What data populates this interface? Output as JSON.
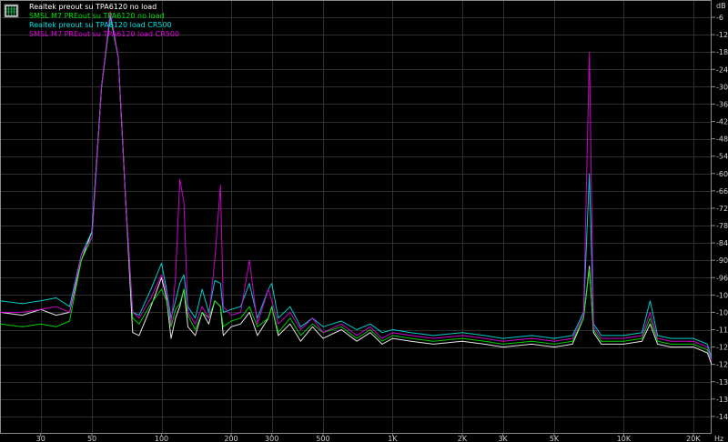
{
  "chart_data": {
    "type": "line",
    "title": "",
    "x_unit": "Hz",
    "y_unit": "dB",
    "x_scale": "log",
    "xlim": [
      20,
      24000
    ],
    "ylim": [
      -150,
      0
    ],
    "grid": true,
    "legend_placement": "top-left",
    "x_ticks": [
      {
        "value": 30,
        "label": "30"
      },
      {
        "value": 50,
        "label": "50"
      },
      {
        "value": 100,
        "label": "100"
      },
      {
        "value": 200,
        "label": "200"
      },
      {
        "value": 300,
        "label": "300"
      },
      {
        "value": 500,
        "label": "500"
      },
      {
        "value": 1000,
        "label": "1K"
      },
      {
        "value": 2000,
        "label": "2K"
      },
      {
        "value": 3000,
        "label": "3K"
      },
      {
        "value": 5000,
        "label": "5K"
      },
      {
        "value": 10000,
        "label": "10K"
      },
      {
        "value": 20000,
        "label": "20K"
      }
    ],
    "y_ticks": [
      -6,
      -12,
      -18,
      -24,
      -30,
      -36,
      -42,
      -48,
      -54,
      -60,
      -66,
      -72,
      -78,
      -84,
      -90,
      -96,
      -102,
      -108,
      -114,
      -120,
      -126,
      -132,
      -138,
      -144
    ],
    "series": [
      {
        "name": "Realtek preout su TPA6120 no load",
        "color": "#ffffff",
        "points": [
          [
            20,
            -108
          ],
          [
            25,
            -109
          ],
          [
            30,
            -107
          ],
          [
            35,
            -109
          ],
          [
            40,
            -108
          ],
          [
            45,
            -90
          ],
          [
            50,
            -80
          ],
          [
            55,
            -30
          ],
          [
            60,
            -5
          ],
          [
            65,
            -20
          ],
          [
            70,
            -70
          ],
          [
            75,
            -115
          ],
          [
            80,
            -116
          ],
          [
            90,
            -106
          ],
          [
            100,
            -96
          ],
          [
            105,
            -103
          ],
          [
            110,
            -117
          ],
          [
            115,
            -110
          ],
          [
            120,
            -106
          ],
          [
            125,
            -100
          ],
          [
            130,
            -113
          ],
          [
            140,
            -116
          ],
          [
            150,
            -108
          ],
          [
            160,
            -112
          ],
          [
            170,
            -104
          ],
          [
            180,
            -106
          ],
          [
            185,
            -116
          ],
          [
            200,
            -113
          ],
          [
            220,
            -112
          ],
          [
            240,
            -108
          ],
          [
            260,
            -116
          ],
          [
            290,
            -110
          ],
          [
            300,
            -106
          ],
          [
            320,
            -116
          ],
          [
            360,
            -112
          ],
          [
            400,
            -118
          ],
          [
            450,
            -113
          ],
          [
            500,
            -117
          ],
          [
            600,
            -114
          ],
          [
            700,
            -118
          ],
          [
            800,
            -115
          ],
          [
            900,
            -119
          ],
          [
            1000,
            -117
          ],
          [
            1200,
            -118
          ],
          [
            1500,
            -119
          ],
          [
            2000,
            -118
          ],
          [
            2500,
            -119
          ],
          [
            3000,
            -120
          ],
          [
            4000,
            -119
          ],
          [
            5000,
            -120
          ],
          [
            6000,
            -119
          ],
          [
            6700,
            -110
          ],
          [
            7100,
            -92
          ],
          [
            7400,
            -115
          ],
          [
            8000,
            -119
          ],
          [
            10000,
            -119
          ],
          [
            12000,
            -118
          ],
          [
            13000,
            -112
          ],
          [
            14000,
            -119
          ],
          [
            16000,
            -120
          ],
          [
            20000,
            -120
          ],
          [
            23000,
            -122
          ],
          [
            24000,
            -126
          ]
        ]
      },
      {
        "name": "SMSL M7 PREout su TPA6120 no load",
        "color": "#00e000",
        "points": [
          [
            20,
            -112
          ],
          [
            25,
            -113
          ],
          [
            30,
            -112
          ],
          [
            35,
            -113
          ],
          [
            40,
            -111
          ],
          [
            45,
            -90
          ],
          [
            50,
            -82
          ],
          [
            55,
            -30
          ],
          [
            60,
            -6
          ],
          [
            65,
            -20
          ],
          [
            70,
            -70
          ],
          [
            75,
            -110
          ],
          [
            80,
            -112
          ],
          [
            90,
            -105
          ],
          [
            100,
            -100
          ],
          [
            105,
            -104
          ],
          [
            110,
            -113
          ],
          [
            115,
            -107
          ],
          [
            120,
            -105
          ],
          [
            125,
            -100
          ],
          [
            130,
            -109
          ],
          [
            140,
            -114
          ],
          [
            150,
            -108
          ],
          [
            160,
            -110
          ],
          [
            170,
            -104
          ],
          [
            180,
            -106
          ],
          [
            185,
            -113
          ],
          [
            200,
            -111
          ],
          [
            220,
            -110
          ],
          [
            240,
            -106
          ],
          [
            260,
            -113
          ],
          [
            290,
            -110
          ],
          [
            300,
            -106
          ],
          [
            320,
            -115
          ],
          [
            360,
            -110
          ],
          [
            400,
            -116
          ],
          [
            450,
            -112
          ],
          [
            500,
            -115
          ],
          [
            600,
            -113
          ],
          [
            700,
            -117
          ],
          [
            800,
            -114
          ],
          [
            900,
            -118
          ],
          [
            1000,
            -116
          ],
          [
            1200,
            -117
          ],
          [
            1500,
            -118
          ],
          [
            2000,
            -117
          ],
          [
            2500,
            -118
          ],
          [
            3000,
            -119
          ],
          [
            4000,
            -118
          ],
          [
            5000,
            -119
          ],
          [
            6000,
            -118
          ],
          [
            6700,
            -110
          ],
          [
            7100,
            -93
          ],
          [
            7400,
            -114
          ],
          [
            8000,
            -118
          ],
          [
            10000,
            -118
          ],
          [
            12000,
            -117
          ],
          [
            13000,
            -110
          ],
          [
            14000,
            -118
          ],
          [
            16000,
            -119
          ],
          [
            20000,
            -119
          ],
          [
            23000,
            -121
          ],
          [
            24000,
            -125
          ]
        ]
      },
      {
        "name": "Realtek preout su TPA6120 load CR500",
        "color": "#00e0e0",
        "points": [
          [
            20,
            -104
          ],
          [
            25,
            -105
          ],
          [
            30,
            -104
          ],
          [
            35,
            -103
          ],
          [
            40,
            -106
          ],
          [
            45,
            -88
          ],
          [
            50,
            -80
          ],
          [
            55,
            -30
          ],
          [
            60,
            -5
          ],
          [
            65,
            -20
          ],
          [
            70,
            -70
          ],
          [
            75,
            -108
          ],
          [
            80,
            -109
          ],
          [
            90,
            -100
          ],
          [
            100,
            -91
          ],
          [
            105,
            -100
          ],
          [
            110,
            -110
          ],
          [
            115,
            -104
          ],
          [
            120,
            -98
          ],
          [
            125,
            -95
          ],
          [
            130,
            -106
          ],
          [
            140,
            -110
          ],
          [
            150,
            -100
          ],
          [
            160,
            -108
          ],
          [
            170,
            -97
          ],
          [
            180,
            -98
          ],
          [
            185,
            -108
          ],
          [
            200,
            -107
          ],
          [
            220,
            -106
          ],
          [
            240,
            -98
          ],
          [
            260,
            -110
          ],
          [
            290,
            -100
          ],
          [
            300,
            -98
          ],
          [
            320,
            -110
          ],
          [
            360,
            -106
          ],
          [
            400,
            -113
          ],
          [
            450,
            -110
          ],
          [
            500,
            -113
          ],
          [
            600,
            -111
          ],
          [
            700,
            -114
          ],
          [
            800,
            -112
          ],
          [
            900,
            -115
          ],
          [
            1000,
            -114
          ],
          [
            1200,
            -115
          ],
          [
            1500,
            -116
          ],
          [
            2000,
            -115
          ],
          [
            2500,
            -116
          ],
          [
            3000,
            -117
          ],
          [
            4000,
            -116
          ],
          [
            5000,
            -117
          ],
          [
            6000,
            -116
          ],
          [
            6700,
            -108
          ],
          [
            7100,
            -60
          ],
          [
            7400,
            -112
          ],
          [
            8000,
            -116
          ],
          [
            10000,
            -116
          ],
          [
            12000,
            -115
          ],
          [
            13000,
            -104
          ],
          [
            14000,
            -116
          ],
          [
            16000,
            -117
          ],
          [
            20000,
            -117
          ],
          [
            23000,
            -119
          ],
          [
            24000,
            -124
          ]
        ]
      },
      {
        "name": "SMSL M7 PREout su TPA6120 load CR500",
        "color": "#e000e0",
        "points": [
          [
            20,
            -108
          ],
          [
            25,
            -108
          ],
          [
            30,
            -107
          ],
          [
            35,
            -106
          ],
          [
            40,
            -108
          ],
          [
            45,
            -88
          ],
          [
            50,
            -82
          ],
          [
            55,
            -30
          ],
          [
            60,
            -4
          ],
          [
            65,
            -20
          ],
          [
            70,
            -70
          ],
          [
            75,
            -108
          ],
          [
            80,
            -110
          ],
          [
            90,
            -103
          ],
          [
            100,
            -95
          ],
          [
            105,
            -101
          ],
          [
            110,
            -112
          ],
          [
            115,
            -96
          ],
          [
            120,
            -62
          ],
          [
            125,
            -70
          ],
          [
            130,
            -108
          ],
          [
            140,
            -112
          ],
          [
            150,
            -106
          ],
          [
            160,
            -110
          ],
          [
            170,
            -90
          ],
          [
            180,
            -64
          ],
          [
            185,
            -106
          ],
          [
            200,
            -109
          ],
          [
            220,
            -108
          ],
          [
            240,
            -90
          ],
          [
            260,
            -112
          ],
          [
            290,
            -100
          ],
          [
            300,
            -104
          ],
          [
            320,
            -112
          ],
          [
            360,
            -108
          ],
          [
            400,
            -114
          ],
          [
            450,
            -110
          ],
          [
            500,
            -115
          ],
          [
            600,
            -112
          ],
          [
            700,
            -116
          ],
          [
            800,
            -113
          ],
          [
            900,
            -117
          ],
          [
            1000,
            -115
          ],
          [
            1200,
            -116
          ],
          [
            1500,
            -117
          ],
          [
            2000,
            -116
          ],
          [
            2500,
            -117
          ],
          [
            3000,
            -118
          ],
          [
            4000,
            -117
          ],
          [
            5000,
            -118
          ],
          [
            6000,
            -117
          ],
          [
            6700,
            -109
          ],
          [
            7100,
            -18
          ],
          [
            7400,
            -113
          ],
          [
            8000,
            -117
          ],
          [
            10000,
            -117
          ],
          [
            12000,
            -116
          ],
          [
            13000,
            -108
          ],
          [
            14000,
            -117
          ],
          [
            16000,
            -118
          ],
          [
            20000,
            -118
          ],
          [
            23000,
            -120
          ],
          [
            24000,
            -125
          ]
        ]
      }
    ]
  },
  "legend_icon": "grid-icon"
}
